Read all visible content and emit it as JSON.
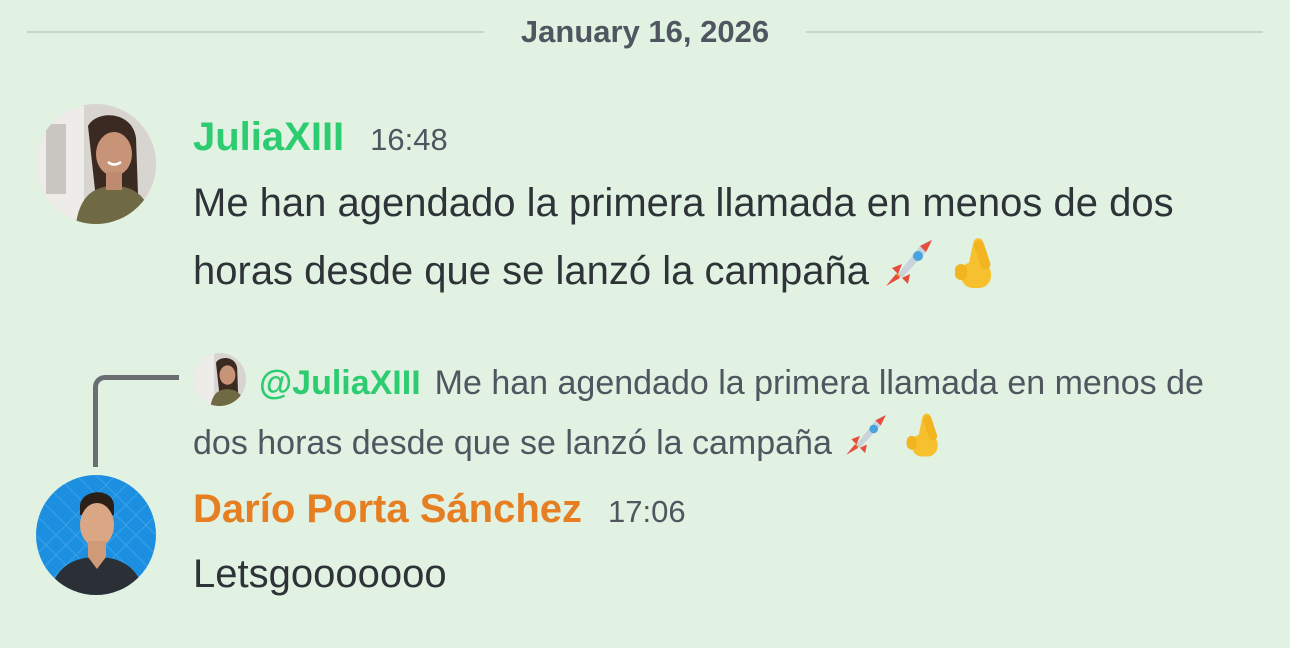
{
  "divider": {
    "date": "January 16, 2026"
  },
  "messages": [
    {
      "author": "JuliaXIII",
      "time": "16:48",
      "text": "Me han agendado la primera llamada en menos de dos horas desde que se lanzó la campaña",
      "emojis": [
        "rocket-emoji",
        "crossed-fingers-emoji"
      ],
      "author_color": "#2ecc71"
    },
    {
      "reply_to": {
        "mention": "@JuliaXIII",
        "text": "Me han agendado la primera llamada en menos de dos horas desde que se lanzó la campaña"
      },
      "author": "Darío Porta Sánchez",
      "time": "17:06",
      "text": "Letsgooooooo",
      "author_color": "#e67e22"
    }
  ],
  "colors": {
    "background": "#e1f2e3",
    "text": "#2e3338",
    "muted": "#4f5660"
  }
}
